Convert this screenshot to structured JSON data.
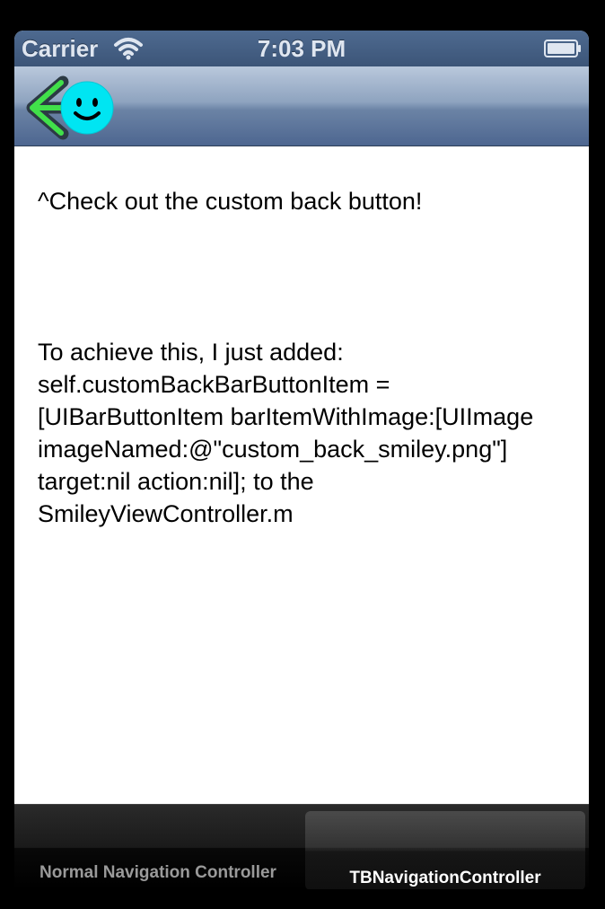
{
  "status_bar": {
    "carrier": "Carrier",
    "time": "7:03 PM",
    "wifi_icon": "wifi-icon",
    "battery_icon": "battery-full-icon"
  },
  "nav_bar": {
    "back_button_icon": "smiley-back-arrow-icon",
    "colors": {
      "arrow": "#41e04a",
      "smiley": "#00e5f2"
    }
  },
  "content": {
    "hint": "^Check out the custom back button!",
    "explanation": "To achieve this, I just added:\nself.customBackBarButtonItem =\n[UIBarButtonItem barItemWithImage:[UIImage\nimageNamed:@\"custom_back_smiley.png\"]\ntarget:nil action:nil]; to the\nSmileyViewController.m"
  },
  "tab_bar": {
    "tabs": [
      {
        "label": "Normal Navigation Controller",
        "selected": false
      },
      {
        "label": "TBNavigationController",
        "selected": true
      }
    ]
  }
}
